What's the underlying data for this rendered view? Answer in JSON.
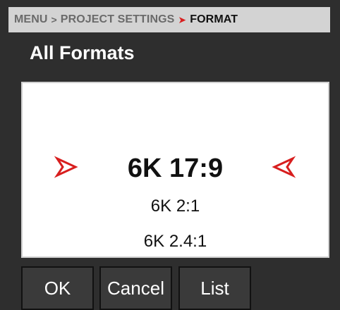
{
  "breadcrumb": {
    "items": [
      "MENU",
      "PROJECT SETTINGS"
    ],
    "current": "FORMAT"
  },
  "page": {
    "title": "All Formats"
  },
  "format_picker": {
    "selected": "6K 17:9",
    "options_below": [
      "6K 2:1",
      "6K 2.4:1"
    ]
  },
  "buttons": {
    "ok": "OK",
    "cancel": "Cancel",
    "list": "List"
  },
  "colors": {
    "accent_red": "#d81e1e",
    "breadcrumb_bg": "#d3d3d3",
    "background": "#2e2e2e"
  }
}
